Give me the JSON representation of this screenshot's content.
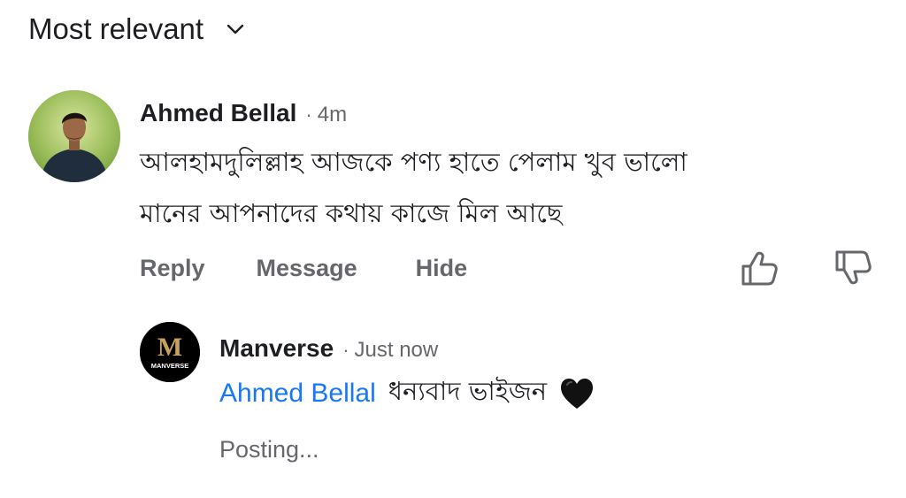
{
  "sort": {
    "label": "Most relevant"
  },
  "comment": {
    "author": "Ahmed Bellal",
    "time": "4m",
    "separator": "·",
    "text_line1": "আলহামদুলিল্লাহ আজকে পণ্য হাতে পেলাম খুব ভালো",
    "text_line2": "মানের আপনাদের কথায় কাজে মিল আছে",
    "actions": {
      "reply": "Reply",
      "message": "Message",
      "hide": "Hide"
    }
  },
  "reply": {
    "author": "Manverse",
    "logo_letter": "M",
    "logo_text": "MANVERSE",
    "separator": "·",
    "time": "Just now",
    "mention": "Ahmed Bellal",
    "text": "ধন্যবাদ ভাইজন",
    "status": "Posting..."
  },
  "icons": {
    "sort": "chevron-down-icon",
    "upvote": "thumbs-up-icon",
    "downvote": "thumbs-down-icon",
    "heart": "black-heart-emoji"
  },
  "colors": {
    "link": "#1877f2",
    "secondary": "#65676b",
    "primary": "#1c1e21",
    "logo_gold": "#c8a25a"
  }
}
